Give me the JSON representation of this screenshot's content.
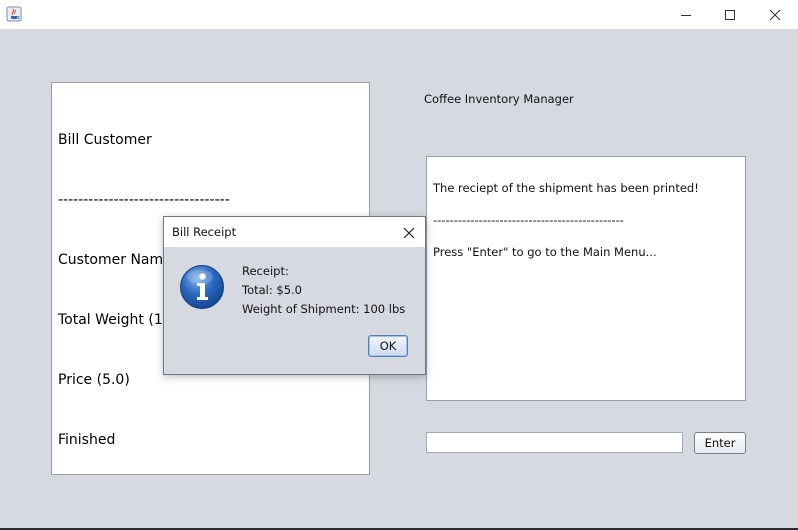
{
  "window": {
    "icon": "java-cup-icon",
    "controls": [
      "minimize-icon",
      "maximize-icon",
      "close-icon"
    ]
  },
  "left_panel": {
    "lines": [
      "Bill Customer",
      "----------------------------------",
      "Customer Name (Test Name)",
      "Total Weight (100)",
      "Price (5.0)",
      "Finished"
    ]
  },
  "app_title": "Coffee Inventory Manager",
  "right_panel": {
    "lines": [
      "The reciept of the shipment has been printed!",
      "----------------------------------------------",
      "Press \"Enter\" to go to the Main Menu..."
    ]
  },
  "input": {
    "value": "",
    "placeholder": ""
  },
  "enter_button_label": "Enter",
  "dialog": {
    "title": "Bill Receipt",
    "icon": "info-icon",
    "lines": [
      "Receipt:",
      "Total: $5.0",
      "Weight of Shipment: 100 lbs"
    ],
    "ok_label": "OK"
  },
  "colors": {
    "background": "#d6d9e0",
    "accent_button_border": "#4f7fbf",
    "info_icon_blue": "#1f5fb0"
  }
}
